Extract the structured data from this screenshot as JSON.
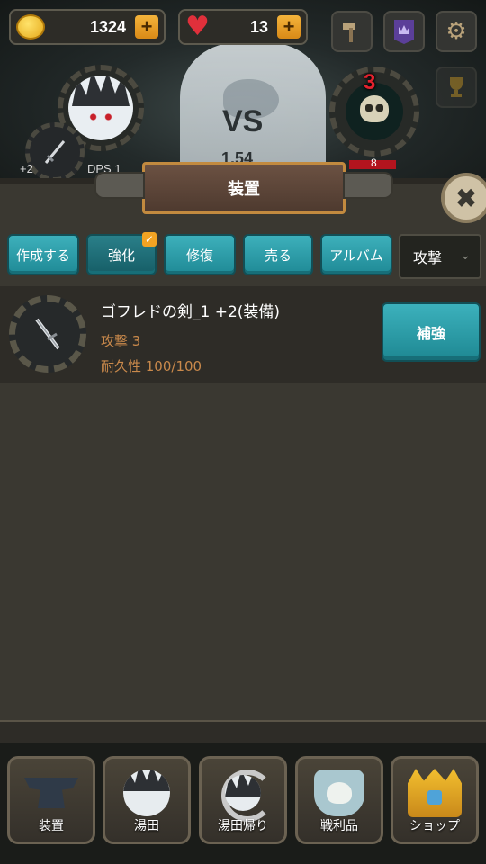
{
  "resources": {
    "coins": "1324",
    "hearts": "13"
  },
  "battle": {
    "vs_label": "VS",
    "enemy_hp": "1.54",
    "enemy_level": "3",
    "enemy_bar_value": "8",
    "weapon_plus": "+2",
    "dps_label": "DPS 1"
  },
  "header": {
    "title": "装置",
    "close_label": "✖"
  },
  "tabs": [
    {
      "label": "作成する",
      "active": false
    },
    {
      "label": "強化",
      "active": true
    },
    {
      "label": "修復",
      "active": false
    },
    {
      "label": "売る",
      "active": false
    },
    {
      "label": "アルバム",
      "active": false
    }
  ],
  "filter": {
    "selected": "攻撃",
    "chevron": "⌄"
  },
  "item": {
    "name": "ゴフレドの剣_1 +2(装備)",
    "attack": "攻撃 3",
    "durability": "耐久性 100/100",
    "action_label": "補強"
  },
  "bottom_nav": [
    {
      "label": "装置",
      "icon": "anvil-icon"
    },
    {
      "label": "湯田",
      "icon": "hero-icon"
    },
    {
      "label": "湯田帰り",
      "icon": "return-icon"
    },
    {
      "label": "戦利品",
      "icon": "loot-icon"
    },
    {
      "label": "ショップ",
      "icon": "shop-chest-icon"
    }
  ],
  "colors": {
    "accent_teal": "#2a9aa6",
    "panel": "#3a3831",
    "gold": "#f2a323",
    "attack_text": "#c9894b"
  }
}
